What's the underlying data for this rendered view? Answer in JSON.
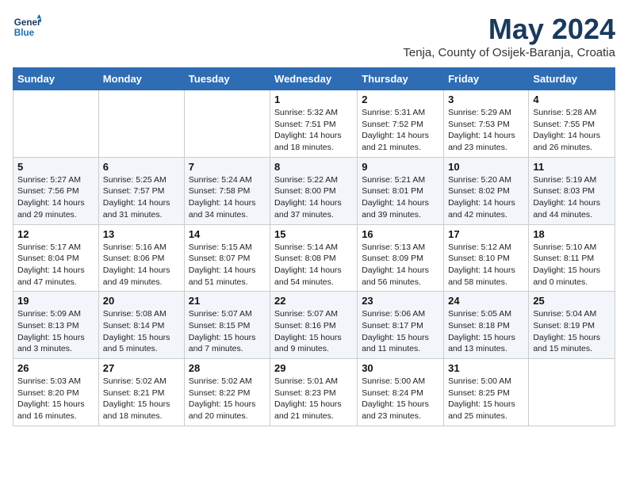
{
  "header": {
    "logo_line1": "General",
    "logo_line2": "Blue",
    "month_title": "May 2024",
    "subtitle": "Tenja, County of Osijek-Baranja, Croatia"
  },
  "days_of_week": [
    "Sunday",
    "Monday",
    "Tuesday",
    "Wednesday",
    "Thursday",
    "Friday",
    "Saturday"
  ],
  "weeks": [
    [
      {
        "day": "",
        "info": ""
      },
      {
        "day": "",
        "info": ""
      },
      {
        "day": "",
        "info": ""
      },
      {
        "day": "1",
        "info": "Sunrise: 5:32 AM\nSunset: 7:51 PM\nDaylight: 14 hours\nand 18 minutes."
      },
      {
        "day": "2",
        "info": "Sunrise: 5:31 AM\nSunset: 7:52 PM\nDaylight: 14 hours\nand 21 minutes."
      },
      {
        "day": "3",
        "info": "Sunrise: 5:29 AM\nSunset: 7:53 PM\nDaylight: 14 hours\nand 23 minutes."
      },
      {
        "day": "4",
        "info": "Sunrise: 5:28 AM\nSunset: 7:55 PM\nDaylight: 14 hours\nand 26 minutes."
      }
    ],
    [
      {
        "day": "5",
        "info": "Sunrise: 5:27 AM\nSunset: 7:56 PM\nDaylight: 14 hours\nand 29 minutes."
      },
      {
        "day": "6",
        "info": "Sunrise: 5:25 AM\nSunset: 7:57 PM\nDaylight: 14 hours\nand 31 minutes."
      },
      {
        "day": "7",
        "info": "Sunrise: 5:24 AM\nSunset: 7:58 PM\nDaylight: 14 hours\nand 34 minutes."
      },
      {
        "day": "8",
        "info": "Sunrise: 5:22 AM\nSunset: 8:00 PM\nDaylight: 14 hours\nand 37 minutes."
      },
      {
        "day": "9",
        "info": "Sunrise: 5:21 AM\nSunset: 8:01 PM\nDaylight: 14 hours\nand 39 minutes."
      },
      {
        "day": "10",
        "info": "Sunrise: 5:20 AM\nSunset: 8:02 PM\nDaylight: 14 hours\nand 42 minutes."
      },
      {
        "day": "11",
        "info": "Sunrise: 5:19 AM\nSunset: 8:03 PM\nDaylight: 14 hours\nand 44 minutes."
      }
    ],
    [
      {
        "day": "12",
        "info": "Sunrise: 5:17 AM\nSunset: 8:04 PM\nDaylight: 14 hours\nand 47 minutes."
      },
      {
        "day": "13",
        "info": "Sunrise: 5:16 AM\nSunset: 8:06 PM\nDaylight: 14 hours\nand 49 minutes."
      },
      {
        "day": "14",
        "info": "Sunrise: 5:15 AM\nSunset: 8:07 PM\nDaylight: 14 hours\nand 51 minutes."
      },
      {
        "day": "15",
        "info": "Sunrise: 5:14 AM\nSunset: 8:08 PM\nDaylight: 14 hours\nand 54 minutes."
      },
      {
        "day": "16",
        "info": "Sunrise: 5:13 AM\nSunset: 8:09 PM\nDaylight: 14 hours\nand 56 minutes."
      },
      {
        "day": "17",
        "info": "Sunrise: 5:12 AM\nSunset: 8:10 PM\nDaylight: 14 hours\nand 58 minutes."
      },
      {
        "day": "18",
        "info": "Sunrise: 5:10 AM\nSunset: 8:11 PM\nDaylight: 15 hours\nand 0 minutes."
      }
    ],
    [
      {
        "day": "19",
        "info": "Sunrise: 5:09 AM\nSunset: 8:13 PM\nDaylight: 15 hours\nand 3 minutes."
      },
      {
        "day": "20",
        "info": "Sunrise: 5:08 AM\nSunset: 8:14 PM\nDaylight: 15 hours\nand 5 minutes."
      },
      {
        "day": "21",
        "info": "Sunrise: 5:07 AM\nSunset: 8:15 PM\nDaylight: 15 hours\nand 7 minutes."
      },
      {
        "day": "22",
        "info": "Sunrise: 5:07 AM\nSunset: 8:16 PM\nDaylight: 15 hours\nand 9 minutes."
      },
      {
        "day": "23",
        "info": "Sunrise: 5:06 AM\nSunset: 8:17 PM\nDaylight: 15 hours\nand 11 minutes."
      },
      {
        "day": "24",
        "info": "Sunrise: 5:05 AM\nSunset: 8:18 PM\nDaylight: 15 hours\nand 13 minutes."
      },
      {
        "day": "25",
        "info": "Sunrise: 5:04 AM\nSunset: 8:19 PM\nDaylight: 15 hours\nand 15 minutes."
      }
    ],
    [
      {
        "day": "26",
        "info": "Sunrise: 5:03 AM\nSunset: 8:20 PM\nDaylight: 15 hours\nand 16 minutes."
      },
      {
        "day": "27",
        "info": "Sunrise: 5:02 AM\nSunset: 8:21 PM\nDaylight: 15 hours\nand 18 minutes."
      },
      {
        "day": "28",
        "info": "Sunrise: 5:02 AM\nSunset: 8:22 PM\nDaylight: 15 hours\nand 20 minutes."
      },
      {
        "day": "29",
        "info": "Sunrise: 5:01 AM\nSunset: 8:23 PM\nDaylight: 15 hours\nand 21 minutes."
      },
      {
        "day": "30",
        "info": "Sunrise: 5:00 AM\nSunset: 8:24 PM\nDaylight: 15 hours\nand 23 minutes."
      },
      {
        "day": "31",
        "info": "Sunrise: 5:00 AM\nSunset: 8:25 PM\nDaylight: 15 hours\nand 25 minutes."
      },
      {
        "day": "",
        "info": ""
      }
    ]
  ]
}
